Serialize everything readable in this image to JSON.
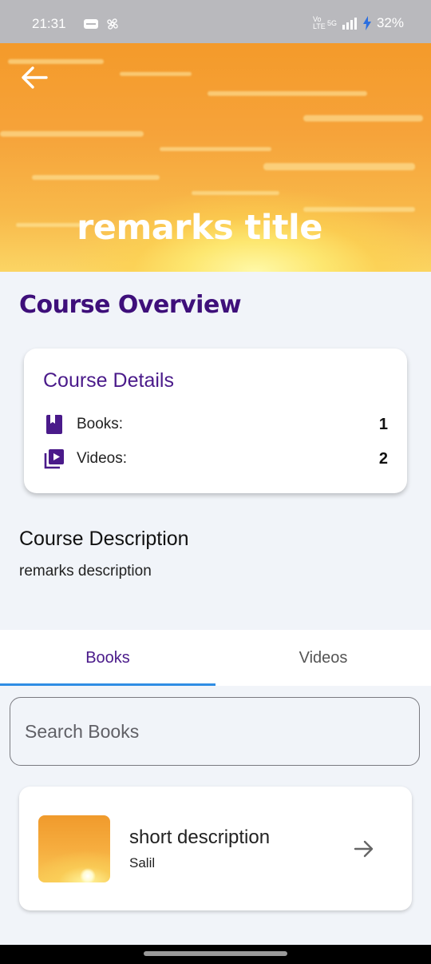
{
  "status_bar": {
    "time": "21:31",
    "network_label": "Vo LTE",
    "network_type": "5G",
    "battery": "32%"
  },
  "header": {
    "title": "remarks title"
  },
  "overview": {
    "title": "Course Overview"
  },
  "details": {
    "title": "Course Details",
    "rows": [
      {
        "label": "Books:",
        "value": "1",
        "icon": "book-icon"
      },
      {
        "label": "Videos:",
        "value": "2",
        "icon": "video-library-icon"
      }
    ]
  },
  "description": {
    "heading": "Course Description",
    "text": "remarks description"
  },
  "tabs": [
    {
      "label": "Books",
      "active": true
    },
    {
      "label": "Videos",
      "active": false
    }
  ],
  "search": {
    "placeholder": "Search Books",
    "value": ""
  },
  "books": [
    {
      "title": "short description",
      "author": "Salil"
    }
  ],
  "colors": {
    "accent": "#3e0f7a",
    "tab_indicator": "#2f8de4",
    "background": "#f1f4f9"
  }
}
